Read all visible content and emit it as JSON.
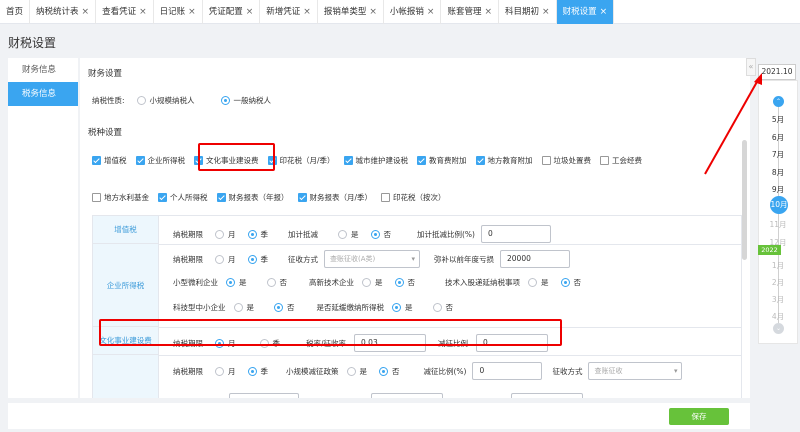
{
  "tabs": [
    {
      "label": "首页",
      "closable": false
    },
    {
      "label": "纳税统计表",
      "closable": true
    },
    {
      "label": "查看凭证",
      "closable": true
    },
    {
      "label": "日记账",
      "closable": true
    },
    {
      "label": "凭证配置",
      "closable": true
    },
    {
      "label": "新增凭证",
      "closable": true
    },
    {
      "label": "报销单类型",
      "closable": true
    },
    {
      "label": "小帐报销",
      "closable": true
    },
    {
      "label": "账套管理",
      "closable": true
    },
    {
      "label": "科目期初",
      "closable": true
    },
    {
      "label": "财税设置",
      "closable": true,
      "active": true
    }
  ],
  "close_glyph": "×",
  "page_title": "财税设置",
  "left_nav": [
    {
      "label": "财务信息",
      "active": false
    },
    {
      "label": "税务信息",
      "active": true
    }
  ],
  "finance": {
    "section_title": "财务设置",
    "taxpayer_label": "纳税性质:",
    "small_scale": "小规模纳税人",
    "general": "一般纳税人"
  },
  "tax_types": {
    "section_title": "税种设置",
    "row1": [
      {
        "label": "增值税",
        "checked": true
      },
      {
        "label": "企业所得税",
        "checked": true
      },
      {
        "label": "文化事业建设费",
        "checked": true
      },
      {
        "label": "印花税（月/季）",
        "checked": true
      },
      {
        "label": "城市维护建设税",
        "checked": true
      },
      {
        "label": "教育费附加",
        "checked": true
      },
      {
        "label": "地方教育附加",
        "checked": true
      },
      {
        "label": "垃圾处置费",
        "checked": false
      },
      {
        "label": "工会经费",
        "checked": false
      }
    ],
    "row2": [
      {
        "label": "地方水利基金",
        "checked": false
      },
      {
        "label": "个人所得税",
        "checked": true
      },
      {
        "label": "财务报表（年报）",
        "checked": true
      },
      {
        "label": "财务报表（月/季）",
        "checked": true
      },
      {
        "label": "印花税（按次）",
        "checked": false
      }
    ]
  },
  "table": {
    "vat": {
      "name": "增值税",
      "period_label": "纳税期限",
      "month": "月",
      "quarter": "季",
      "addl_label": "加计抵减",
      "yes": "是",
      "no": "否",
      "ratio_label": "加计抵减比例(%)",
      "ratio_value": "0"
    },
    "cit": {
      "name": "企业所得税",
      "period_label": "纳税期限",
      "month": "月",
      "quarter": "季",
      "method_label": "征收方式",
      "method_placeholder": "查账征收(A类)",
      "loss_label": "弥补以前年度亏损",
      "loss_value": "20000",
      "small_label": "小型微利企业",
      "hitech_label": "高新技术企业",
      "tech_label": "技术入股递延纳税事项",
      "sme_label": "科技型中小企业",
      "defer_label": "是否延缓缴纳所得税",
      "yes": "是",
      "no": "否"
    },
    "culture": {
      "name": "文化事业建设费",
      "period_label": "纳税期限",
      "month": "月",
      "quarter": "季",
      "rate_label": "税率/征收率",
      "rate_value": "0.03",
      "reduce_label": "减征比例",
      "reduce_value": "0"
    },
    "stamp": {
      "period_label": "纳税期限",
      "month": "月",
      "quarter": "季",
      "policy_label": "小规模减征政策",
      "yes": "是",
      "no": "否",
      "reduce_label": "减征比例(%)",
      "reduce_value": "0",
      "method_label": "征收方式",
      "method_placeholder": "查账征收"
    }
  },
  "save_label": "保存",
  "timeline": {
    "date_badge": "2021.10",
    "handle_glyph": "«",
    "up_glyph": "⌃",
    "down_glyph": "⌄",
    "months_2021": [
      "5月",
      "6月",
      "7月",
      "8月",
      "9月"
    ],
    "current": "10月",
    "after": [
      "11月",
      "12月"
    ],
    "year_2022": "2022",
    "months_2022": [
      "1月",
      "2月",
      "3月",
      "4月"
    ]
  }
}
